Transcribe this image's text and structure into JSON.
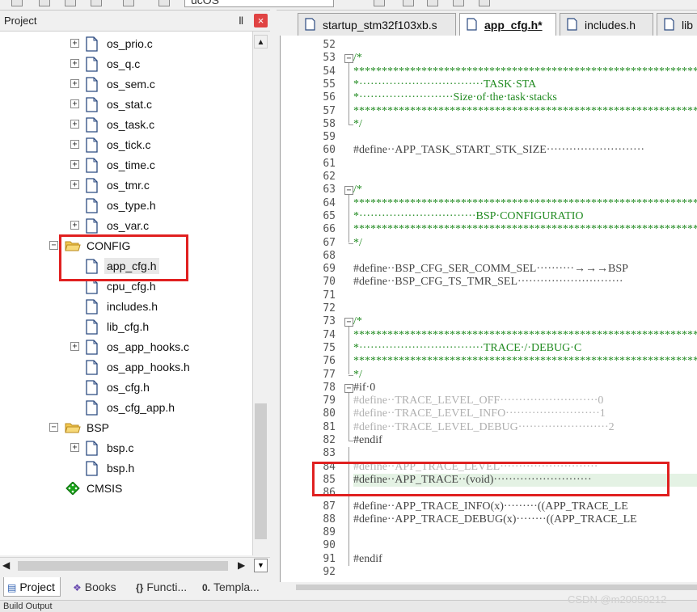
{
  "toolbar": {
    "target_name": "ucOS"
  },
  "project_panel": {
    "title": "Project",
    "pin_glyph": "Ⅱ",
    "close_glyph": "×"
  },
  "tree": {
    "items": [
      {
        "label": "os_prio.c",
        "kind": "file",
        "expandable": true
      },
      {
        "label": "os_q.c",
        "kind": "file",
        "expandable": true
      },
      {
        "label": "os_sem.c",
        "kind": "file",
        "expandable": true
      },
      {
        "label": "os_stat.c",
        "kind": "file",
        "expandable": true
      },
      {
        "label": "os_task.c",
        "kind": "file",
        "expandable": true
      },
      {
        "label": "os_tick.c",
        "kind": "file",
        "expandable": true
      },
      {
        "label": "os_time.c",
        "kind": "file",
        "expandable": true
      },
      {
        "label": "os_tmr.c",
        "kind": "file",
        "expandable": true
      },
      {
        "label": "os_type.h",
        "kind": "file",
        "expandable": false
      },
      {
        "label": "os_var.c",
        "kind": "file",
        "expandable": true
      },
      {
        "label": "CONFIG",
        "kind": "folder",
        "expandable": true
      },
      {
        "label": "app_cfg.h",
        "kind": "file",
        "expandable": false,
        "selected": true
      },
      {
        "label": "cpu_cfg.h",
        "kind": "file",
        "expandable": false
      },
      {
        "label": "includes.h",
        "kind": "file",
        "expandable": false
      },
      {
        "label": "lib_cfg.h",
        "kind": "file",
        "expandable": false
      },
      {
        "label": "os_app_hooks.c",
        "kind": "file",
        "expandable": true
      },
      {
        "label": "os_app_hooks.h",
        "kind": "file",
        "expandable": false
      },
      {
        "label": "os_cfg.h",
        "kind": "file",
        "expandable": false
      },
      {
        "label": "os_cfg_app.h",
        "kind": "file",
        "expandable": false
      },
      {
        "label": "BSP",
        "kind": "folder",
        "expandable": true
      },
      {
        "label": "bsp.c",
        "kind": "file",
        "expandable": true
      },
      {
        "label": "bsp.h",
        "kind": "file",
        "expandable": false
      },
      {
        "label": "CMSIS",
        "kind": "component",
        "expandable": false
      }
    ]
  },
  "bottom_tabs": [
    {
      "label": "Project",
      "icon": "project-icon",
      "active": true
    },
    {
      "label": "Books",
      "icon": "books-icon",
      "active": false
    },
    {
      "label": "Functi...",
      "icon": "functions-icon",
      "active": false
    },
    {
      "label": "Templa...",
      "icon": "templates-icon",
      "active": false
    }
  ],
  "status_bar": {
    "text": "Build Output"
  },
  "editor_tabs": [
    {
      "label": "startup_stm32f103xb.s",
      "active": false
    },
    {
      "label": "app_cfg.h*",
      "active": true
    },
    {
      "label": "includes.h",
      "active": false
    },
    {
      "label": "lib",
      "active": false
    }
  ],
  "code": {
    "lines": [
      {
        "n": "52",
        "t": ""
      },
      {
        "n": "53",
        "t": "/*",
        "cls": "c-cmt"
      },
      {
        "n": "54",
        "t": "*********************************************************************************",
        "cls": "c-cmt"
      },
      {
        "n": "55",
        "t": "*·································TASK·STA",
        "cls": "c-cmt"
      },
      {
        "n": "56",
        "t": "*·························Size·of·the·task·stacks",
        "cls": "c-cmt"
      },
      {
        "n": "57",
        "t": "*********************************************************************************",
        "cls": "c-cmt"
      },
      {
        "n": "58",
        "t": "*/",
        "cls": "c-cmt"
      },
      {
        "n": "59",
        "t": ""
      },
      {
        "n": "60",
        "t": "#define··APP_TASK_START_STK_SIZE··························",
        "cls": "c-pp"
      },
      {
        "n": "61",
        "t": ""
      },
      {
        "n": "62",
        "t": ""
      },
      {
        "n": "63",
        "t": "/*",
        "cls": "c-cmt"
      },
      {
        "n": "64",
        "t": "*********************************************************************************",
        "cls": "c-cmt"
      },
      {
        "n": "65",
        "t": "*·······························BSP·CONFIGURATIO",
        "cls": "c-cmt"
      },
      {
        "n": "66",
        "t": "*********************************************************************************",
        "cls": "c-cmt"
      },
      {
        "n": "67",
        "t": "*/",
        "cls": "c-cmt"
      },
      {
        "n": "68",
        "t": ""
      },
      {
        "n": "69",
        "t": "#define··BSP_CFG_SER_COMM_SEL··········→→→BSP",
        "cls": "c-pp"
      },
      {
        "n": "70",
        "t": "#define··BSP_CFG_TS_TMR_SEL····························",
        "cls": "c-pp"
      },
      {
        "n": "71",
        "t": ""
      },
      {
        "n": "72",
        "t": ""
      },
      {
        "n": "73",
        "t": "/*",
        "cls": "c-cmt"
      },
      {
        "n": "74",
        "t": "*********************************************************************************",
        "cls": "c-cmt"
      },
      {
        "n": "75",
        "t": "*·································TRACE·/·DEBUG·C",
        "cls": "c-cmt"
      },
      {
        "n": "76",
        "t": "*********************************************************************************",
        "cls": "c-cmt"
      },
      {
        "n": "77",
        "t": "*/",
        "cls": "c-cmt"
      },
      {
        "n": "78",
        "t": "#if·0",
        "cls": "c-pp"
      },
      {
        "n": "79",
        "t": "#define··TRACE_LEVEL_OFF··························0",
        "cls": "c-dim"
      },
      {
        "n": "80",
        "t": "#define··TRACE_LEVEL_INFO·························1",
        "cls": "c-dim"
      },
      {
        "n": "81",
        "t": "#define··TRACE_LEVEL_DEBUG························2",
        "cls": "c-dim"
      },
      {
        "n": "82",
        "t": "#endif",
        "cls": "c-pp"
      },
      {
        "n": "83",
        "t": ""
      },
      {
        "n": "84",
        "t": "#define··APP_TRACE_LEVEL··························",
        "cls": "c-dim"
      },
      {
        "n": "85",
        "t": "#define··APP_TRACE··(void)··························",
        "cls": "c-pp",
        "hl": true
      },
      {
        "n": "86",
        "t": ""
      },
      {
        "n": "87",
        "t": "#define··APP_TRACE_INFO(x)·········((APP_TRACE_LE",
        "cls": "c-pp"
      },
      {
        "n": "88",
        "t": "#define··APP_TRACE_DEBUG(x)········((APP_TRACE_LE",
        "cls": "c-pp"
      },
      {
        "n": "89",
        "t": ""
      },
      {
        "n": "90",
        "t": ""
      },
      {
        "n": "91",
        "t": "#endif",
        "cls": "c-pp"
      },
      {
        "n": "92",
        "t": ""
      }
    ]
  },
  "watermark": "CSDN @m20050212",
  "colors": {
    "annotation_red": "#e02020",
    "close_red": "#e04343",
    "comment_green": "#228b22",
    "highlight_green": "#e4f2e4"
  }
}
